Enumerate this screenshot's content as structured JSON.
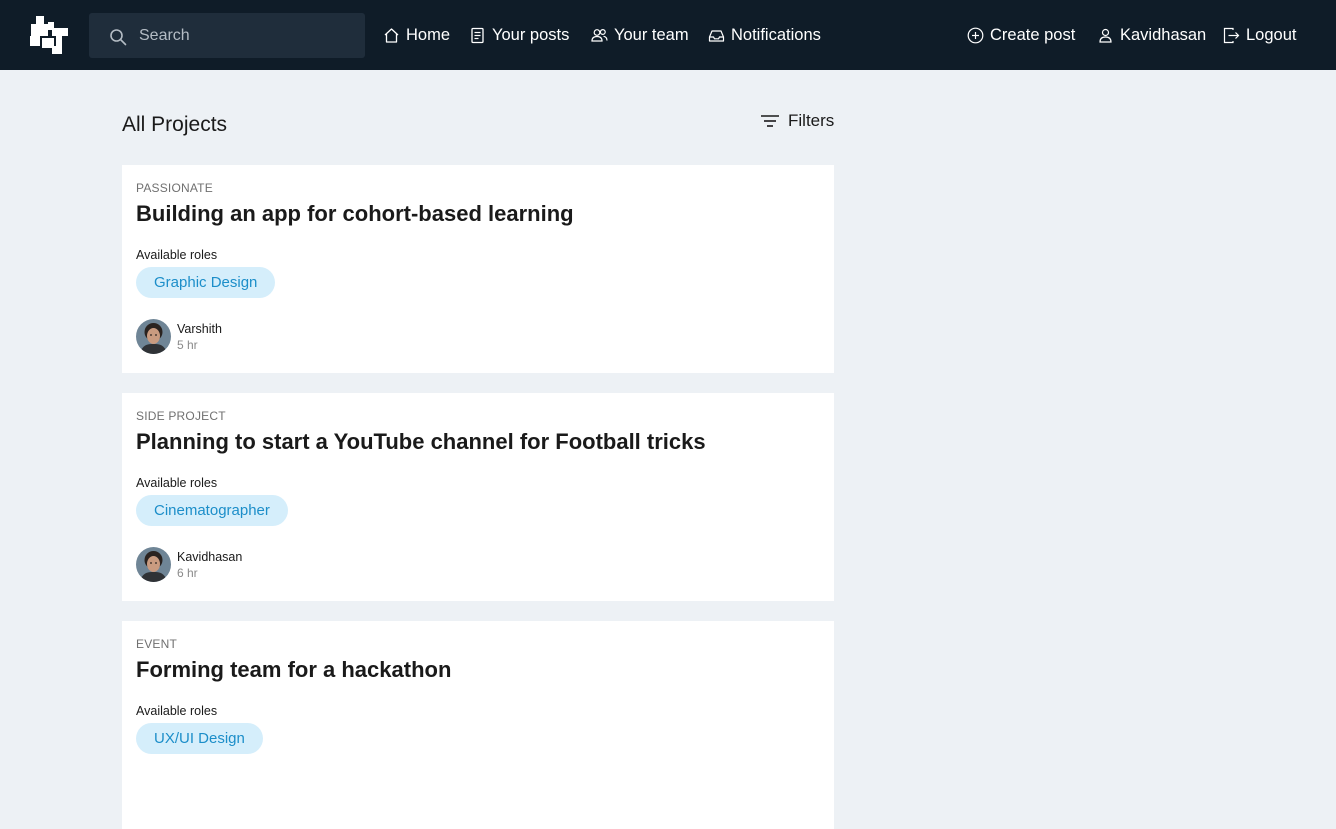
{
  "header": {
    "search_placeholder": "Search",
    "nav": {
      "home": "Home",
      "your_posts": "Your posts",
      "your_team": "Your team",
      "notifications": "Notifications",
      "create_post": "Create post",
      "user": "Kavidhasan",
      "logout": "Logout"
    },
    "icons": {
      "home": "home-icon",
      "your_posts": "document-icon",
      "your_team": "team-icon",
      "notifications": "inbox-icon",
      "create_post": "plus-circle-icon",
      "user": "user-icon",
      "logout": "logout-icon",
      "search": "search-icon"
    }
  },
  "main": {
    "title": "All Projects",
    "filters_label": "Filters",
    "projects": [
      {
        "category": "PASSIONATE",
        "title": "Building an app for cohort-based learning",
        "roles_label": "Available roles",
        "roles": [
          "Graphic Design"
        ],
        "author": "Varshith",
        "time": "5 hr"
      },
      {
        "category": "SIDE PROJECT",
        "title": "Planning to start a YouTube channel for Football tricks",
        "roles_label": "Available roles",
        "roles": [
          "Cinematographer"
        ],
        "author": "Kavidhasan",
        "time": "6 hr"
      },
      {
        "category": "EVENT",
        "title": "Forming team for a hackathon",
        "roles_label": "Available roles",
        "roles": [
          "UX/UI Design"
        ],
        "author": "",
        "time": ""
      }
    ]
  },
  "colors": {
    "header_bg": "#0f1c28",
    "search_bg": "#1f2d3b",
    "page_bg": "#edf1f5",
    "pill_bg": "#d5eefb",
    "pill_text": "#1c8ec9"
  }
}
